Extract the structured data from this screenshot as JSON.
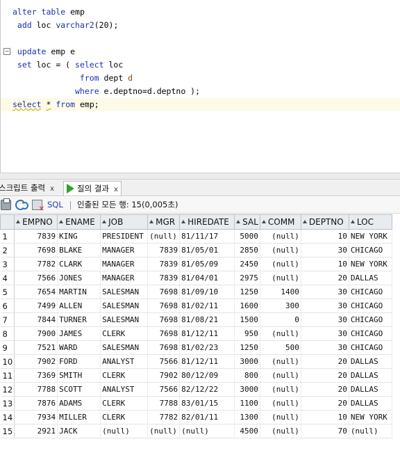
{
  "editor": {
    "lines": [
      {
        "parts": [
          [
            "kw",
            "alter table"
          ],
          [
            "id",
            " emp"
          ]
        ]
      },
      {
        "parts": [
          [
            "kw",
            " add"
          ],
          [
            "id",
            " loc "
          ],
          [
            "kw",
            "varchar2"
          ],
          [
            "id",
            "("
          ],
          [
            "num",
            "20"
          ],
          [
            "id",
            ");"
          ]
        ]
      },
      {
        "parts": []
      },
      {
        "parts": [
          [
            "kw",
            " update"
          ],
          [
            "id",
            " emp e"
          ]
        ]
      },
      {
        "parts": [
          [
            "kw",
            " set"
          ],
          [
            "id",
            " loc = ( "
          ],
          [
            "kw",
            "select"
          ],
          [
            "id",
            " loc"
          ]
        ]
      },
      {
        "parts": [
          [
            "kw",
            "              from"
          ],
          [
            "id",
            " dept "
          ],
          [
            "alias",
            "d"
          ]
        ]
      },
      {
        "parts": [
          [
            "kw",
            "             where"
          ],
          [
            "id",
            " e.deptno=d.deptno );"
          ]
        ]
      },
      {
        "parts": [
          [
            "kw squig",
            "select"
          ],
          [
            "id",
            " "
          ],
          [
            "id squig",
            "*"
          ],
          [
            "id",
            " "
          ],
          [
            "kw",
            "from"
          ],
          [
            "id",
            " emp;"
          ]
        ]
      }
    ],
    "fold_glyph": "−"
  },
  "tabs": [
    {
      "label": "스크립트 출력",
      "close": "x"
    },
    {
      "label": "질의 결과",
      "close": "x"
    }
  ],
  "toolbar": {
    "sql_label": "SQL",
    "status": "인출된 모든 행: 15(0,005초)"
  },
  "columns": [
    "EMPNO",
    "ENAME",
    "JOB",
    "MGR",
    "HIREDATE",
    "SAL",
    "COMM",
    "DEPTNO",
    "LOC"
  ],
  "rows": [
    [
      "1",
      "7839",
      "KING",
      "PRESIDENT",
      "(null)",
      "81/11/17",
      "5000",
      "(null)",
      "10",
      "NEW YORK"
    ],
    [
      "2",
      "7698",
      "BLAKE",
      "MANAGER",
      "7839",
      "81/05/01",
      "2850",
      "(null)",
      "30",
      "CHICAGO"
    ],
    [
      "3",
      "7782",
      "CLARK",
      "MANAGER",
      "7839",
      "81/05/09",
      "2450",
      "(null)",
      "10",
      "NEW YORK"
    ],
    [
      "4",
      "7566",
      "JONES",
      "MANAGER",
      "7839",
      "81/04/01",
      "2975",
      "(null)",
      "20",
      "DALLAS"
    ],
    [
      "5",
      "7654",
      "MARTIN",
      "SALESMAN",
      "7698",
      "81/09/10",
      "1250",
      "1400",
      "30",
      "CHICAGO"
    ],
    [
      "6",
      "7499",
      "ALLEN",
      "SALESMAN",
      "7698",
      "81/02/11",
      "1600",
      "300",
      "30",
      "CHICAGO"
    ],
    [
      "7",
      "7844",
      "TURNER",
      "SALESMAN",
      "7698",
      "81/08/21",
      "1500",
      "0",
      "30",
      "CHICAGO"
    ],
    [
      "8",
      "7900",
      "JAMES",
      "CLERK",
      "7698",
      "81/12/11",
      "950",
      "(null)",
      "30",
      "CHICAGO"
    ],
    [
      "9",
      "7521",
      "WARD",
      "SALESMAN",
      "7698",
      "81/02/23",
      "1250",
      "500",
      "30",
      "CHICAGO"
    ],
    [
      "10",
      "7902",
      "FORD",
      "ANALYST",
      "7566",
      "81/12/11",
      "3000",
      "(null)",
      "20",
      "DALLAS"
    ],
    [
      "11",
      "7369",
      "SMITH",
      "CLERK",
      "7902",
      "80/12/09",
      "800",
      "(null)",
      "20",
      "DALLAS"
    ],
    [
      "12",
      "7788",
      "SCOTT",
      "ANALYST",
      "7566",
      "82/12/22",
      "3000",
      "(null)",
      "20",
      "DALLAS"
    ],
    [
      "13",
      "7876",
      "ADAMS",
      "CLERK",
      "7788",
      "83/01/15",
      "1100",
      "(null)",
      "20",
      "DALLAS"
    ],
    [
      "14",
      "7934",
      "MILLER",
      "CLERK",
      "7782",
      "82/01/11",
      "1300",
      "(null)",
      "10",
      "NEW YORK"
    ],
    [
      "15",
      "2921",
      "JACK",
      "(null)",
      "(null)",
      "(null)",
      "4500",
      "(null)",
      "70",
      "(null)"
    ]
  ],
  "icons": {
    "print": "print-icon",
    "refresh": "refresh-icon",
    "grid_delete": "grid-delete-icon",
    "run": "run-query-icon"
  }
}
